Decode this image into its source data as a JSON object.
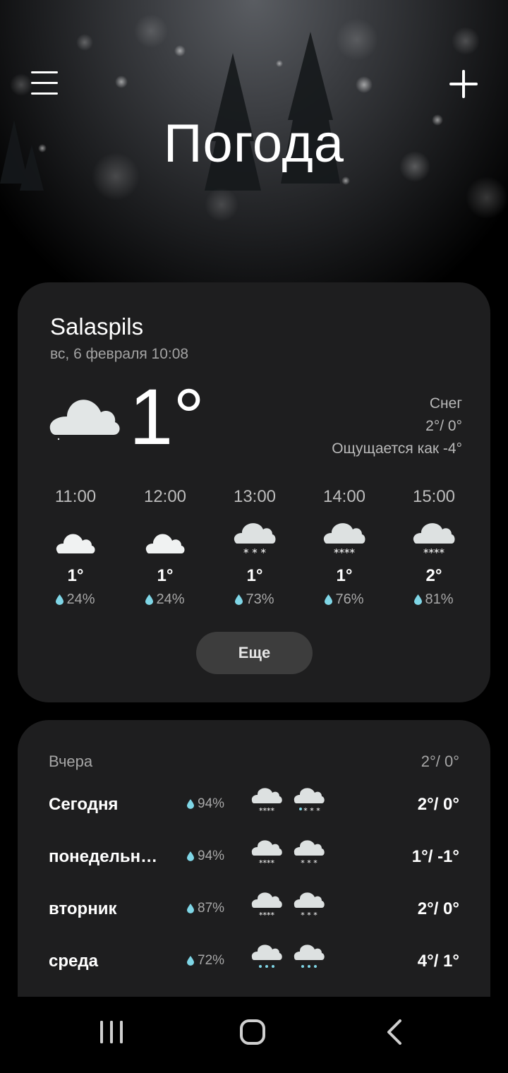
{
  "header": {
    "title": "Погода"
  },
  "current": {
    "city": "Salaspils",
    "datetime": "вс, 6 февраля 10:08",
    "temp": "1°",
    "condition": "Снег",
    "high_low": "2°/ 0°",
    "feels_like": "Ощущается как -4°"
  },
  "hourly": [
    {
      "time": "11:00",
      "icon": "cloud-icon",
      "temp": "1°",
      "pop": "24%"
    },
    {
      "time": "12:00",
      "icon": "cloud-icon",
      "temp": "1°",
      "pop": "24%"
    },
    {
      "time": "13:00",
      "icon": "snow-icon",
      "temp": "1°",
      "pop": "73%"
    },
    {
      "time": "14:00",
      "icon": "heavy-snow-icon",
      "temp": "1°",
      "pop": "76%"
    },
    {
      "time": "15:00",
      "icon": "heavy-snow-icon",
      "temp": "2°",
      "pop": "81%"
    }
  ],
  "more_label": "Еще",
  "daily": {
    "yesterday_label": "Вчера",
    "yesterday_temp": "2°/ 0°",
    "days": [
      {
        "name": "Сегодня",
        "pop": "94%",
        "icon_day": "heavy-snow-icon",
        "icon_night": "sleet-icon",
        "temp": "2°/ 0°"
      },
      {
        "name": "понедельн…",
        "pop": "94%",
        "icon_day": "heavy-snow-icon",
        "icon_night": "snow-icon",
        "temp": "1°/ -1°"
      },
      {
        "name": "вторник",
        "pop": "87%",
        "icon_day": "heavy-snow-icon",
        "icon_night": "snow-icon",
        "temp": "2°/ 0°"
      },
      {
        "name": "среда",
        "pop": "72%",
        "icon_day": "rain-icon",
        "icon_night": "rain-icon",
        "temp": "4°/ 1°"
      }
    ]
  },
  "colors": {
    "card": "#1e1e1f",
    "drop": "#7fd6e6",
    "icon": "#e3e6e6"
  }
}
